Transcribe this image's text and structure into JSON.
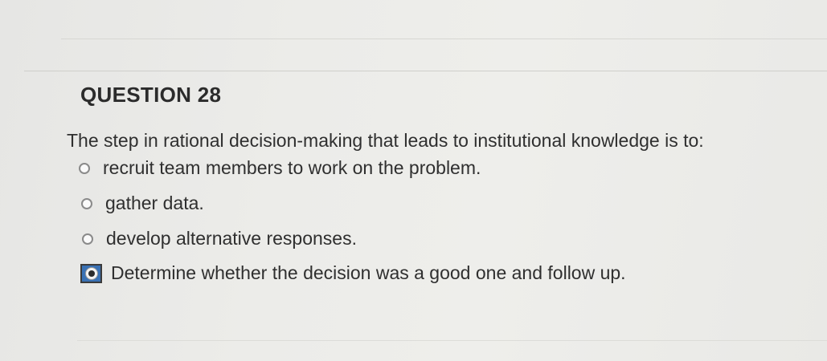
{
  "question": {
    "title": "QUESTION 28",
    "text": "The step in rational decision-making that leads to institutional knowledge is to:"
  },
  "options": [
    {
      "label": "recruit team members to work on the problem.",
      "selected": false
    },
    {
      "label": "gather data.",
      "selected": false
    },
    {
      "label": "develop alternative responses.",
      "selected": false
    },
    {
      "label": "Determine whether the decision was a good one and follow up.",
      "selected": true
    }
  ],
  "colors": {
    "selected_highlight": "#3a72b5",
    "text": "#2f2f2f"
  }
}
